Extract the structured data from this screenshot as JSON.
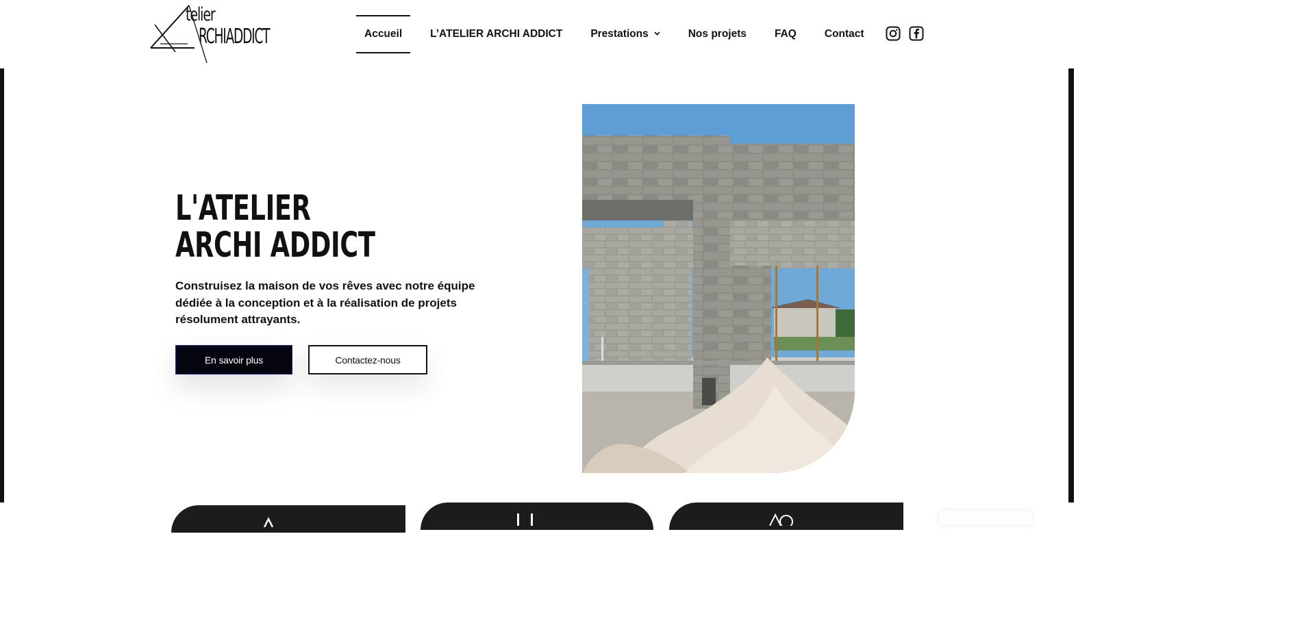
{
  "brand": {
    "logo_line_1": "telier",
    "logo_line_2": "RCHIADDICT"
  },
  "nav": {
    "items": [
      {
        "label": "Accueil",
        "active": true
      },
      {
        "label": "L’ATELIER ARCHI ADDICT"
      },
      {
        "label": "Prestations",
        "has_dropdown": true
      },
      {
        "label": "Nos projets"
      },
      {
        "label": "FAQ"
      },
      {
        "label": "Contact"
      }
    ]
  },
  "social": {
    "icons": [
      "instagram-icon",
      "facebook-icon"
    ]
  },
  "hero": {
    "title_line_1": "L'ATELIER",
    "title_line_2": "ARCHI ADDICT",
    "description": "Construisez la maison de vos rêves avec notre équipe dédiée à la conception et à la réalisation de projets résolument attrayants.",
    "primary_button": "En savoir plus",
    "secondary_button": "Contactez-nous"
  },
  "colors": {
    "text": "#111111",
    "button_primary_bg": "#050510",
    "card_bg": "#1c1c1c",
    "sky": "#7fb3dc",
    "concrete": "#8a8a86"
  }
}
